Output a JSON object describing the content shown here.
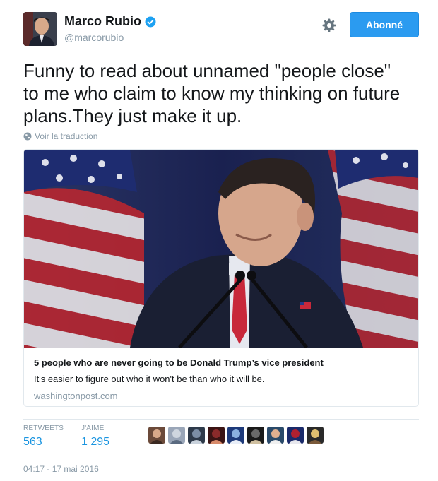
{
  "author": {
    "name": "Marco Rubio",
    "handle": "@marcorubio",
    "verified_icon": "verified-badge-icon"
  },
  "actions": {
    "follow_label": "Abonné",
    "settings_icon": "gear-icon"
  },
  "tweet": {
    "lines": [
      "Funny to read about unnamed \"people close\"",
      "to me who claim to know my thinking on future",
      "plans.They just make it up."
    ],
    "translate_label": "Voir la traduction"
  },
  "card": {
    "title": "5 people who are never going to be Donald Trump’s vice president",
    "description": "It's easier to figure out who it won't be than who it will be.",
    "domain": "washingtonpost.com"
  },
  "stats": {
    "retweets_label": "RETWEETS",
    "retweets_value": "563",
    "likes_label": "J'AIME",
    "likes_value": "1 295",
    "liker_avatar_count": 9
  },
  "timestamp": "04:17 - 17 mai 2016",
  "colors": {
    "accent": "#1b95e0",
    "follow_button": "#2b9bf0",
    "muted_text": "#8899a6",
    "border": "#e1e8ed"
  }
}
